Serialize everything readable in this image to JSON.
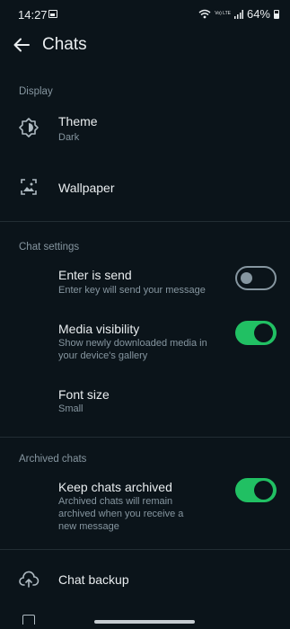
{
  "status_bar": {
    "time": "14:27",
    "network": "Vo) LTE",
    "battery": "64%"
  },
  "app_bar": {
    "title": "Chats"
  },
  "sections": {
    "display": {
      "header": "Display",
      "theme": {
        "title": "Theme",
        "subtitle": "Dark",
        "icon": "brightness-icon"
      },
      "wallpaper": {
        "title": "Wallpaper",
        "icon": "wallpaper-icon"
      }
    },
    "chat_settings": {
      "header": "Chat settings",
      "enter_is_send": {
        "title": "Enter is send",
        "subtitle": "Enter key will send your message",
        "enabled": false
      },
      "media_visibility": {
        "title": "Media visibility",
        "subtitle": "Show newly downloaded media in your device's gallery",
        "enabled": true
      },
      "font_size": {
        "title": "Font size",
        "subtitle": "Small"
      }
    },
    "archived_chats": {
      "header": "Archived chats",
      "keep_archived": {
        "title": "Keep chats archived",
        "subtitle": "Archived chats will remain archived when you receive a new message",
        "enabled": true
      }
    },
    "backup": {
      "chat_backup": {
        "title": "Chat backup",
        "icon": "cloud-upload-icon"
      }
    }
  },
  "colors": {
    "background": "#0b141a",
    "accent": "#21c063",
    "secondary_text": "#8696a0"
  }
}
